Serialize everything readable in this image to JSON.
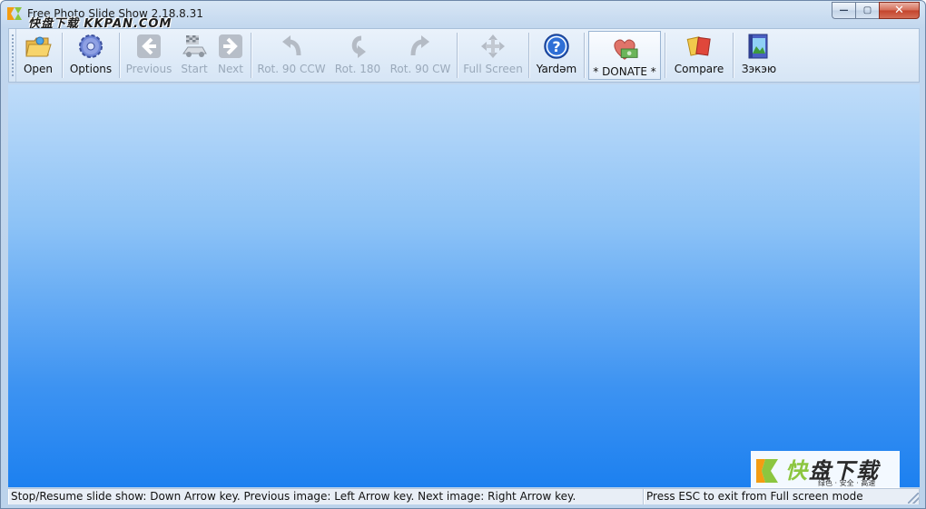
{
  "window": {
    "title": "Free Photo Slide Show 2.18.8.31",
    "watermark_text": "快盘下载 KKPAN.COM"
  },
  "titlebar_buttons": {
    "minimize": "—",
    "maximize": "▢",
    "close": "✕"
  },
  "toolbar": {
    "open": {
      "label": "Open",
      "icon": "open-folder-icon"
    },
    "options": {
      "label": "Options",
      "icon": "gear-icon"
    },
    "previous": {
      "label": "Previous",
      "icon": "arrow-left-icon"
    },
    "start": {
      "label": "Start",
      "icon": "race-car-icon"
    },
    "next": {
      "label": "Next",
      "icon": "arrow-right-icon"
    },
    "rot_ccw": {
      "label": "Rot. 90 CCW",
      "icon": "rotate-ccw-icon"
    },
    "rot_180": {
      "label": "Rot. 180",
      "icon": "rotate-180-icon"
    },
    "rot_cw": {
      "label": "Rot. 90 CW",
      "icon": "rotate-cw-icon"
    },
    "full_screen": {
      "label": "Full Screen",
      "icon": "move-arrows-icon"
    },
    "help": {
      "label": "Yardəm",
      "icon": "help-icon"
    },
    "donate": {
      "label": "* DONATE *",
      "icon": "heart-money-icon"
    },
    "compare": {
      "label": "Compare",
      "icon": "compare-cards-icon"
    },
    "gallery": {
      "label": "Зэкэю",
      "icon": "photo-book-icon"
    }
  },
  "logo": {
    "name_first": "快",
    "name_rest": "盘下载",
    "tagline": "绿色 · 安全 · 高速"
  },
  "status": {
    "left": "Stop/Resume slide show: Down Arrow key. Previous image: Left Arrow key. Next image: Right Arrow key.",
    "right": "Press ESC to exit from Full screen mode"
  },
  "colors": {
    "accent": "#1c80f0",
    "gradient_top": "#bfdcf9",
    "disabled_text": "#9aa9ba"
  }
}
